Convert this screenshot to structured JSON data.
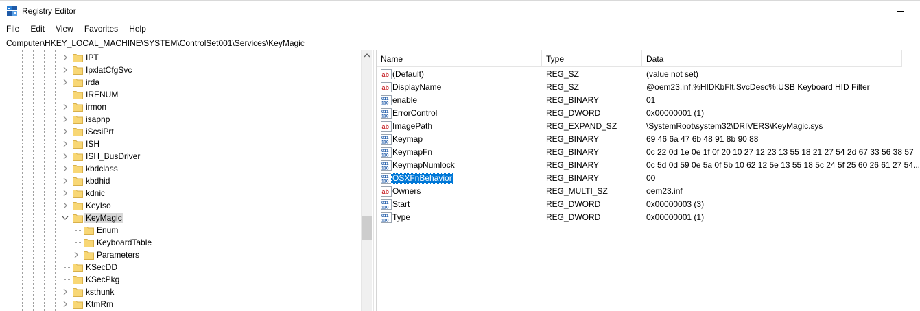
{
  "window": {
    "title": "Registry Editor"
  },
  "menu": [
    "File",
    "Edit",
    "View",
    "Favorites",
    "Help"
  ],
  "address": {
    "path": "Computer\\HKEY_LOCAL_MACHINE\\SYSTEM\\ControlSet001\\Services\\KeyMagic"
  },
  "tree": {
    "items": [
      {
        "label": "IPT",
        "level": 0,
        "expander": "collapsed",
        "selected": false
      },
      {
        "label": "IpxlatCfgSvc",
        "level": 0,
        "expander": "collapsed",
        "selected": false
      },
      {
        "label": "irda",
        "level": 0,
        "expander": "collapsed",
        "selected": false
      },
      {
        "label": "IRENUM",
        "level": 0,
        "expander": "none",
        "selected": false
      },
      {
        "label": "irmon",
        "level": 0,
        "expander": "collapsed",
        "selected": false
      },
      {
        "label": "isapnp",
        "level": 0,
        "expander": "collapsed",
        "selected": false
      },
      {
        "label": "iScsiPrt",
        "level": 0,
        "expander": "collapsed",
        "selected": false
      },
      {
        "label": "ISH",
        "level": 0,
        "expander": "collapsed",
        "selected": false
      },
      {
        "label": "ISH_BusDriver",
        "level": 0,
        "expander": "collapsed",
        "selected": false
      },
      {
        "label": "kbdclass",
        "level": 0,
        "expander": "collapsed",
        "selected": false
      },
      {
        "label": "kbdhid",
        "level": 0,
        "expander": "collapsed",
        "selected": false
      },
      {
        "label": "kdnic",
        "level": 0,
        "expander": "collapsed",
        "selected": false
      },
      {
        "label": "KeyIso",
        "level": 0,
        "expander": "collapsed",
        "selected": false
      },
      {
        "label": "KeyMagic",
        "level": 0,
        "expander": "expanded",
        "selected": true
      },
      {
        "label": "Enum",
        "level": 1,
        "expander": "none",
        "selected": false
      },
      {
        "label": "KeyboardTable",
        "level": 1,
        "expander": "none",
        "selected": false
      },
      {
        "label": "Parameters",
        "level": 1,
        "expander": "collapsed",
        "selected": false
      },
      {
        "label": "KSecDD",
        "level": 0,
        "expander": "none",
        "selected": false
      },
      {
        "label": "KSecPkg",
        "level": 0,
        "expander": "none",
        "selected": false
      },
      {
        "label": "ksthunk",
        "level": 0,
        "expander": "collapsed",
        "selected": false
      },
      {
        "label": "KtmRm",
        "level": 0,
        "expander": "collapsed",
        "selected": false
      }
    ]
  },
  "values": {
    "columns": [
      "Name",
      "Type",
      "Data"
    ],
    "rows": [
      {
        "icon": "string-value-icon",
        "name": "(Default)",
        "type": "REG_SZ",
        "data": "(value not set)",
        "selected": false
      },
      {
        "icon": "string-value-icon",
        "name": "DisplayName",
        "type": "REG_SZ",
        "data": "@oem23.inf,%HIDKbFlt.SvcDesc%;USB Keyboard HID Filter",
        "selected": false
      },
      {
        "icon": "binary-value-icon",
        "name": "enable",
        "type": "REG_BINARY",
        "data": "01",
        "selected": false
      },
      {
        "icon": "binary-value-icon",
        "name": "ErrorControl",
        "type": "REG_DWORD",
        "data": "0x00000001 (1)",
        "selected": false
      },
      {
        "icon": "string-value-icon",
        "name": "ImagePath",
        "type": "REG_EXPAND_SZ",
        "data": "\\SystemRoot\\system32\\DRIVERS\\KeyMagic.sys",
        "selected": false
      },
      {
        "icon": "binary-value-icon",
        "name": "Keymap",
        "type": "REG_BINARY",
        "data": "69 46 6a 47 6b 48 91 8b 90 88",
        "selected": false
      },
      {
        "icon": "binary-value-icon",
        "name": "KeymapFn",
        "type": "REG_BINARY",
        "data": "0c 22 0d 1e 0e 1f 0f 20 10 27 12 23 13 55 18 21 27 54 2d 67 33 56 38 57",
        "selected": false
      },
      {
        "icon": "binary-value-icon",
        "name": "KeymapNumlock",
        "type": "REG_BINARY",
        "data": "0c 5d 0d 59 0e 5a 0f 5b 10 62 12 5e 13 55 18 5c 24 5f 25 60 26 61 27 54...",
        "selected": false
      },
      {
        "icon": "binary-value-icon",
        "name": "OSXFnBehavior",
        "type": "REG_BINARY",
        "data": "00",
        "selected": true
      },
      {
        "icon": "string-value-icon",
        "name": "Owners",
        "type": "REG_MULTI_SZ",
        "data": "oem23.inf",
        "selected": false
      },
      {
        "icon": "binary-value-icon",
        "name": "Start",
        "type": "REG_DWORD",
        "data": "0x00000003 (3)",
        "selected": false
      },
      {
        "icon": "binary-value-icon",
        "name": "Type",
        "type": "REG_DWORD",
        "data": "0x00000001 (1)",
        "selected": false
      }
    ]
  },
  "colors": {
    "selection": "#0078d7",
    "tree_selection": "#d9d9d9",
    "folder": "#f8d775",
    "string_icon": "#c8282d",
    "binary_icon": "#1e5aa8"
  }
}
